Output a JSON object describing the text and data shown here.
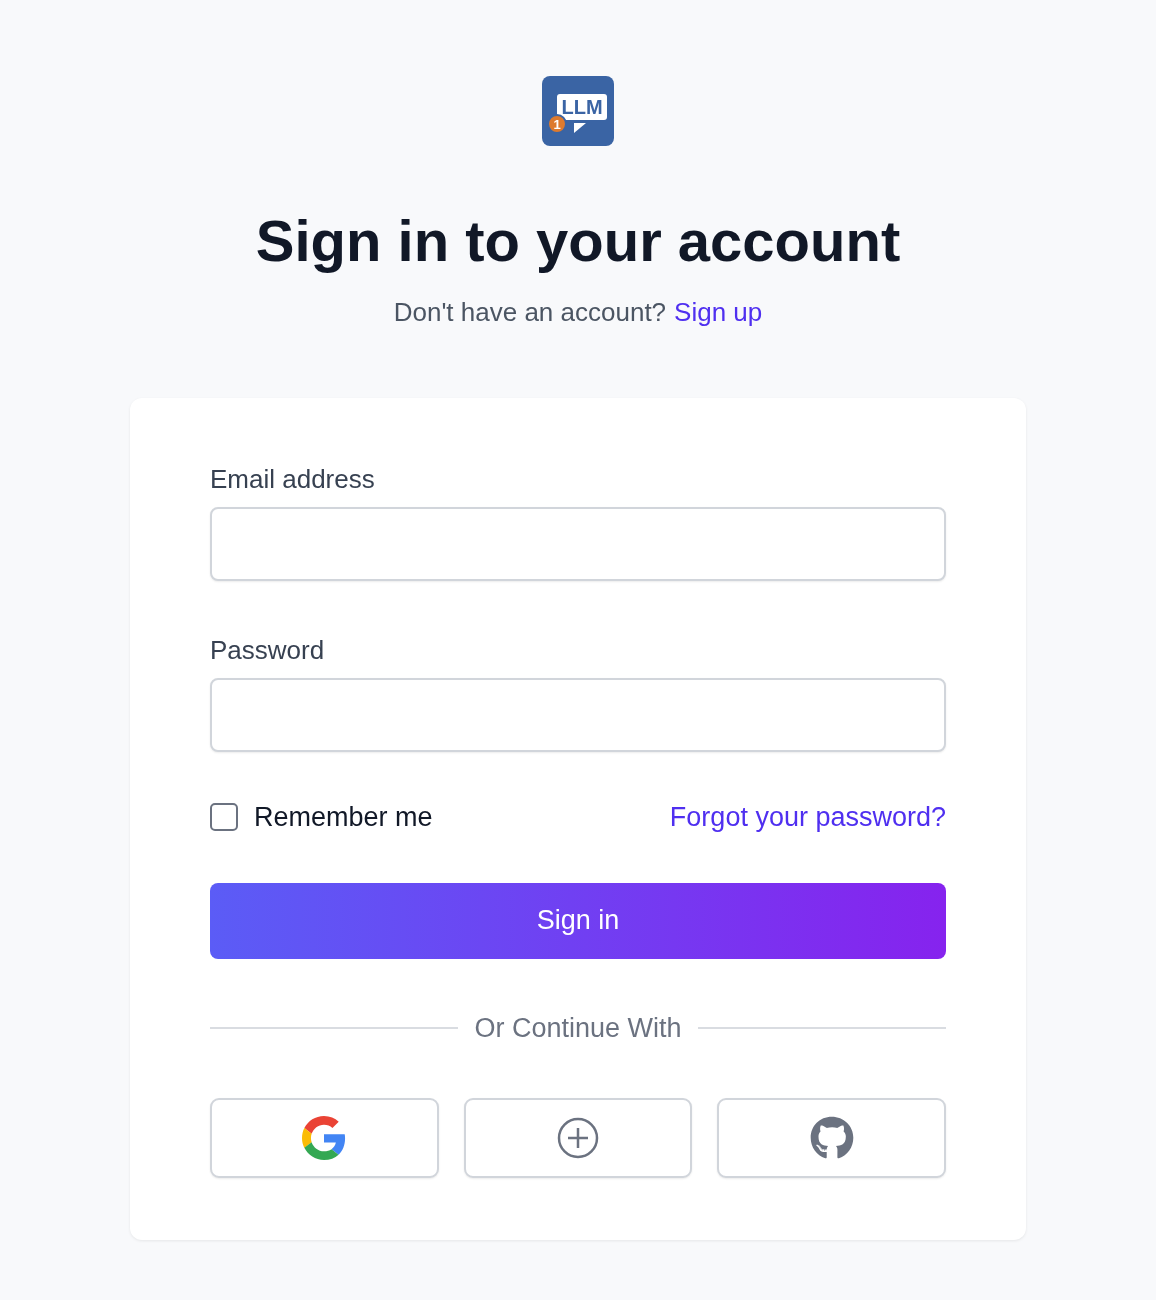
{
  "logo": {
    "text": "LLM",
    "badge": "1"
  },
  "title": "Sign in to your account",
  "subtitle": {
    "text": "Don't have an account?",
    "link": "Sign up"
  },
  "form": {
    "fields": [
      {
        "label": "Email address"
      },
      {
        "label": "Password"
      }
    ],
    "remember": {
      "label": "Remember me",
      "checked": false
    },
    "forgot": "Forgot your password?",
    "submit": "Sign in",
    "divider": "Or Continue With",
    "providers": [
      {
        "kind": "google"
      },
      {
        "kind": "plus"
      },
      {
        "kind": "github"
      }
    ]
  }
}
